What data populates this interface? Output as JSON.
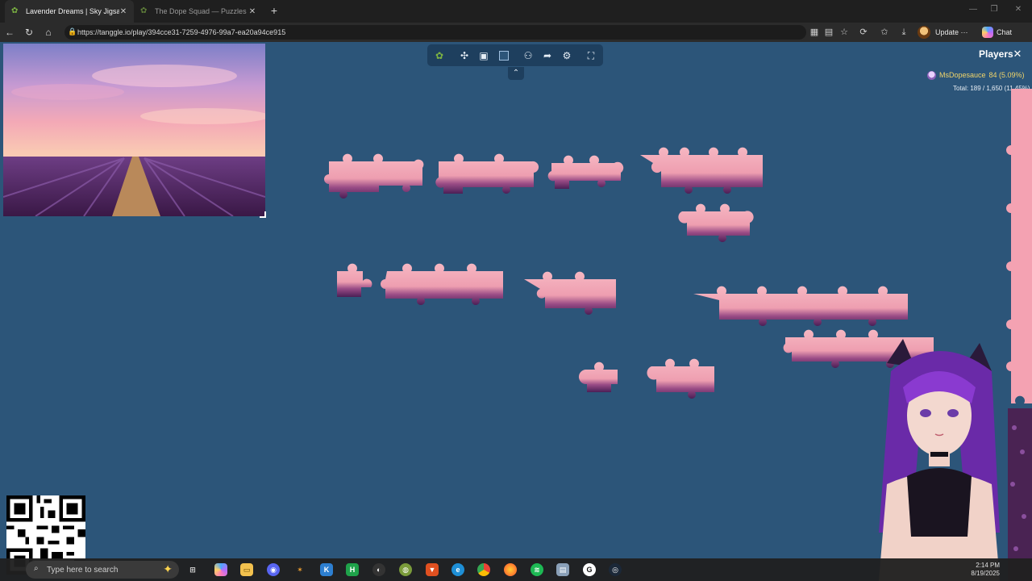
{
  "browser": {
    "tabs": [
      {
        "title": "Lavender Dreams | Sky Jigsaw",
        "active": true
      },
      {
        "title": "The Dope Squad — Puzzles",
        "active": false
      }
    ],
    "url": "https://tanggle.io/play/394cce31-7259-4976-99a7-ea20a94ce915",
    "update_label": "Update",
    "update_more": "···",
    "chat_label": "Chat"
  },
  "toolbar": {
    "items": [
      "tanggle-logo-icon",
      "puzzle-piece-icon",
      "image-icon",
      "background-color-icon",
      "players-icon",
      "share-icon",
      "settings-icon",
      "fullscreen-icon"
    ],
    "collapse_icon": "chevrons-up-icon",
    "background_color": "#2c5579"
  },
  "players_panel": {
    "title": "Players",
    "player_name": "MsDopesauce",
    "player_score": "84 (5.09%)",
    "total": "Total: 189 / 1,650 (11.45%)"
  },
  "taskbar": {
    "search_placeholder": "Type here to search",
    "time": "2:14 PM",
    "date": "8/19/2025"
  },
  "colors": {
    "canvas": "#2c5579",
    "piece_sky": "#f2a6b6",
    "piece_lavender": "#5b2a63"
  }
}
